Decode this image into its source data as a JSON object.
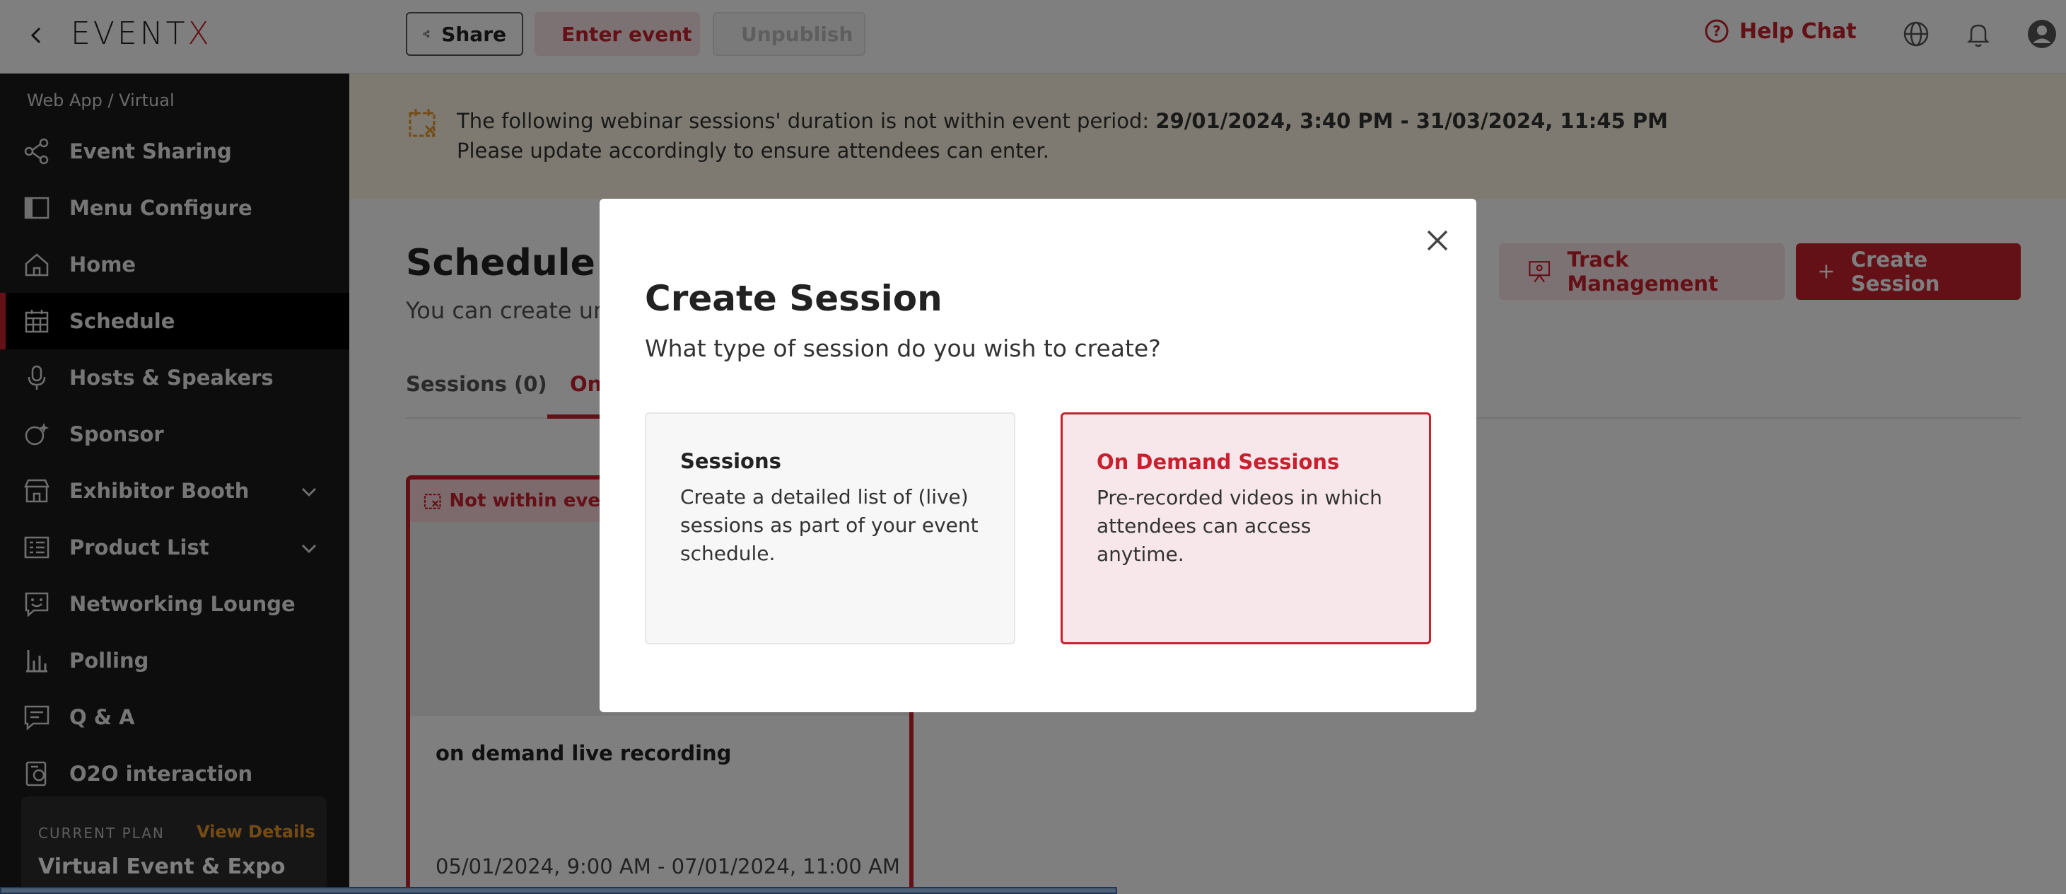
{
  "topbar": {
    "logo": "EVENTX",
    "share_label": "Share",
    "enter_label": "Enter event",
    "unpublish_label": "Unpublish",
    "help_label": "Help Chat"
  },
  "sidebar": {
    "breadcrumb": "Web App / Virtual",
    "items": [
      {
        "label": "Event Sharing",
        "icon": "share-icon"
      },
      {
        "label": "Menu Configure",
        "icon": "sidebar-layout-icon"
      },
      {
        "label": "Home",
        "icon": "home-icon"
      },
      {
        "label": "Schedule",
        "icon": "calendar-grid-icon",
        "active": true
      },
      {
        "label": "Hosts & Speakers",
        "icon": "microphone-icon"
      },
      {
        "label": "Sponsor",
        "icon": "sponsor-icon"
      },
      {
        "label": "Exhibitor Booth",
        "icon": "storefront-icon",
        "expandable": true
      },
      {
        "label": "Product List",
        "icon": "list-icon",
        "expandable": true
      },
      {
        "label": "Networking Lounge",
        "icon": "chat-smile-icon"
      },
      {
        "label": "Polling",
        "icon": "bar-chart-icon"
      },
      {
        "label": "Q & A",
        "icon": "message-icon"
      },
      {
        "label": "O2O interaction",
        "icon": "o2o-icon"
      }
    ],
    "plan": {
      "caption": "CURRENT PLAN",
      "link": "View Details",
      "name": "Virtual Event & Expo"
    }
  },
  "notice": {
    "line1_prefix": "The following webinar sessions' duration is not within event period: ",
    "line1_period": "29/01/2024, 3:40 PM - 31/03/2024, 11:45 PM",
    "line2": "Please update accordingly to ensure attendees can enter."
  },
  "schedule": {
    "title": "Schedule",
    "subtitle": "You can create unl",
    "track_button": "Track Management",
    "create_button": "Create Session",
    "tabs": [
      {
        "label": "Sessions (0)"
      },
      {
        "label": "On"
      }
    ],
    "card": {
      "flag": "Not within event",
      "title": "on demand live recording",
      "date": "05/01/2024, 9:00 AM - 07/01/2024, 11:00 AM"
    }
  },
  "modal": {
    "title": "Create Session",
    "subtitle": "What type of session do you wish to create?",
    "options": [
      {
        "title": "Sessions",
        "desc": "Create a detailed list of (live) sessions as part of your event schedule."
      },
      {
        "title": "On Demand Sessions",
        "desc": "Pre-recorded videos in which attendees can access anytime."
      }
    ]
  },
  "colors": {
    "accent": "#c8202e",
    "sidebar_bg": "#1b1b1b",
    "notice_bg": "#fdf4e2",
    "plan_link": "#e8962e"
  }
}
